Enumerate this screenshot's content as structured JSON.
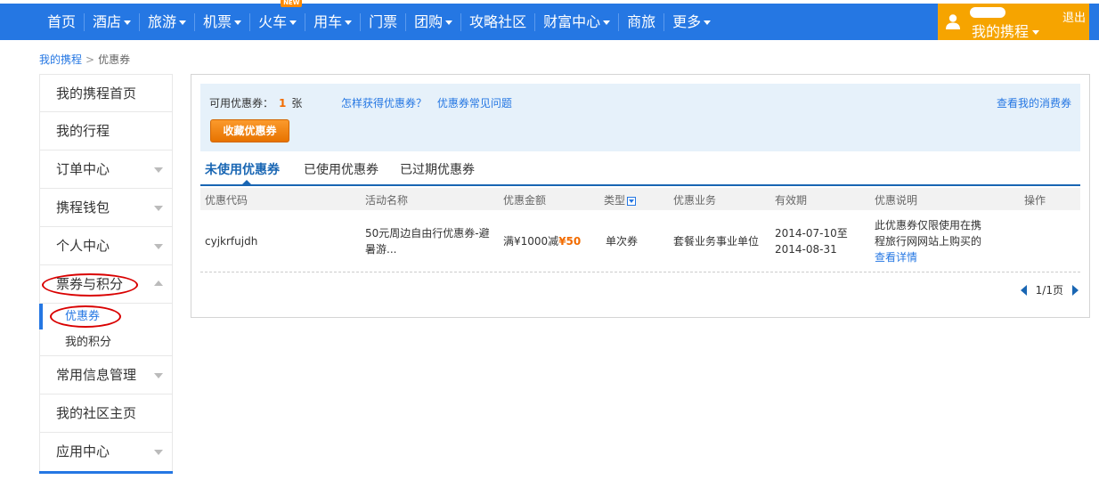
{
  "nav": {
    "items": [
      {
        "label": "首页",
        "caret": false
      },
      {
        "label": "酒店",
        "caret": true
      },
      {
        "label": "旅游",
        "caret": true
      },
      {
        "label": "机票",
        "caret": true
      },
      {
        "label": "火车",
        "caret": true,
        "badge": "NEW"
      },
      {
        "label": "用车",
        "caret": true
      },
      {
        "label": "门票",
        "caret": false
      },
      {
        "label": "团购",
        "caret": true
      },
      {
        "label": "攻略社区",
        "caret": false
      },
      {
        "label": "财富中心",
        "caret": true
      },
      {
        "label": "商旅",
        "caret": false
      },
      {
        "label": "更多",
        "caret": true
      }
    ],
    "user": {
      "my_trip": "我的携程",
      "logout": "退出"
    }
  },
  "breadcrumb": {
    "home": "我的携程",
    "current": "优惠券"
  },
  "sidebar": {
    "items": [
      {
        "label": "我的携程首页"
      },
      {
        "label": "我的行程"
      },
      {
        "label": "订单中心"
      },
      {
        "label": "携程钱包"
      },
      {
        "label": "个人中心"
      },
      {
        "label": "票券与积分"
      },
      {
        "label": "常用信息管理"
      },
      {
        "label": "我的社区主页"
      },
      {
        "label": "应用中心"
      }
    ],
    "sub_items": [
      {
        "label": "优惠券"
      },
      {
        "label": "我的积分"
      }
    ]
  },
  "info": {
    "available_label": "可用优惠券：",
    "available_count": "1",
    "available_unit": "张",
    "link_how": "怎样获得优惠券？",
    "link_faq": "优惠券常见问题",
    "link_consumer": "查看我的消费券",
    "collect_button": "收藏优惠券"
  },
  "tabs": [
    {
      "label": "未使用优惠券",
      "active": true
    },
    {
      "label": "已使用优惠券",
      "active": false
    },
    {
      "label": "已过期优惠券",
      "active": false
    }
  ],
  "table": {
    "headers": [
      "优惠代码",
      "活动名称",
      "优惠金额",
      "类型",
      "优惠业务",
      "有效期",
      "优惠说明",
      "操作"
    ],
    "rows": [
      {
        "code": "cyjkrfujdh",
        "name_line1": "50元周边自由行优惠券-避",
        "name_line2": "暑游...",
        "amount_prefix": "满¥1000减",
        "amount_value": "¥50",
        "type": "单次券",
        "business": "套餐业务事业单位",
        "valid_line1": "2014-07-10至",
        "valid_line2": "2014-08-31",
        "desc_line1": "此优惠券仅限使用在携",
        "desc_line2": "程旅行网网站上购买的",
        "desc_link": "查看详情"
      }
    ]
  },
  "pager": {
    "text": "1/1页"
  },
  "colors": {
    "nav_blue": "#2577e3",
    "user_orange": "#f6a400",
    "accent_orange": "#f26c00",
    "dark_blue": "#1966b3",
    "annotation_red": "#d90000"
  }
}
